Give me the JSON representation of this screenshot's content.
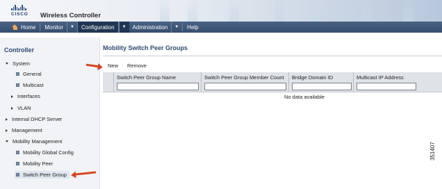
{
  "header": {
    "logo_text": "CISCO",
    "app_title": "Wireless Controller"
  },
  "nav": {
    "items": [
      {
        "label": "Home",
        "icon": "home-icon"
      },
      {
        "label": "Monitor"
      },
      {
        "label": "Configuration",
        "active": true
      },
      {
        "label": "Administration"
      },
      {
        "label": "Help"
      }
    ],
    "caret": "▼"
  },
  "sidebar": {
    "title": "Controller",
    "tree": [
      {
        "label": "System",
        "state": "expanded"
      },
      {
        "label": "General",
        "type": "leaf"
      },
      {
        "label": "Multicast",
        "type": "leaf"
      },
      {
        "label": "Interfaces",
        "state": "collapsed"
      },
      {
        "label": "VLAN",
        "state": "collapsed"
      },
      {
        "label": "Internal DHCP Server",
        "state": "collapsed"
      },
      {
        "label": "Management",
        "state": "collapsed"
      },
      {
        "label": "Mobility Management",
        "state": "expanded"
      },
      {
        "label": "Mobility Global Config",
        "type": "leaf"
      },
      {
        "label": "Mobility Peer",
        "type": "leaf"
      },
      {
        "label": "Switch Peer Group",
        "type": "leaf",
        "selected": true
      }
    ]
  },
  "main": {
    "page_title": "Mobility Switch Peer Groups",
    "toolbar": {
      "new_label": "New",
      "remove_label": "Remove"
    },
    "table": {
      "columns": [
        "Switch Peer Group Name",
        "Switch Peer Group Member Count",
        "Bridge Domain ID",
        "Multicast IP Address"
      ],
      "filters": [
        "",
        "",
        "",
        ""
      ],
      "empty_message": "No data available"
    }
  },
  "figure_id": "351407",
  "colors": {
    "nav_bg": "#364e6e",
    "nav_active": "#203753",
    "title_blue": "#2d4a73",
    "arrow_red": "#d8421f",
    "sidebar_bg": "#f1f3f6",
    "table_header_bg": "#dfe3e8"
  }
}
